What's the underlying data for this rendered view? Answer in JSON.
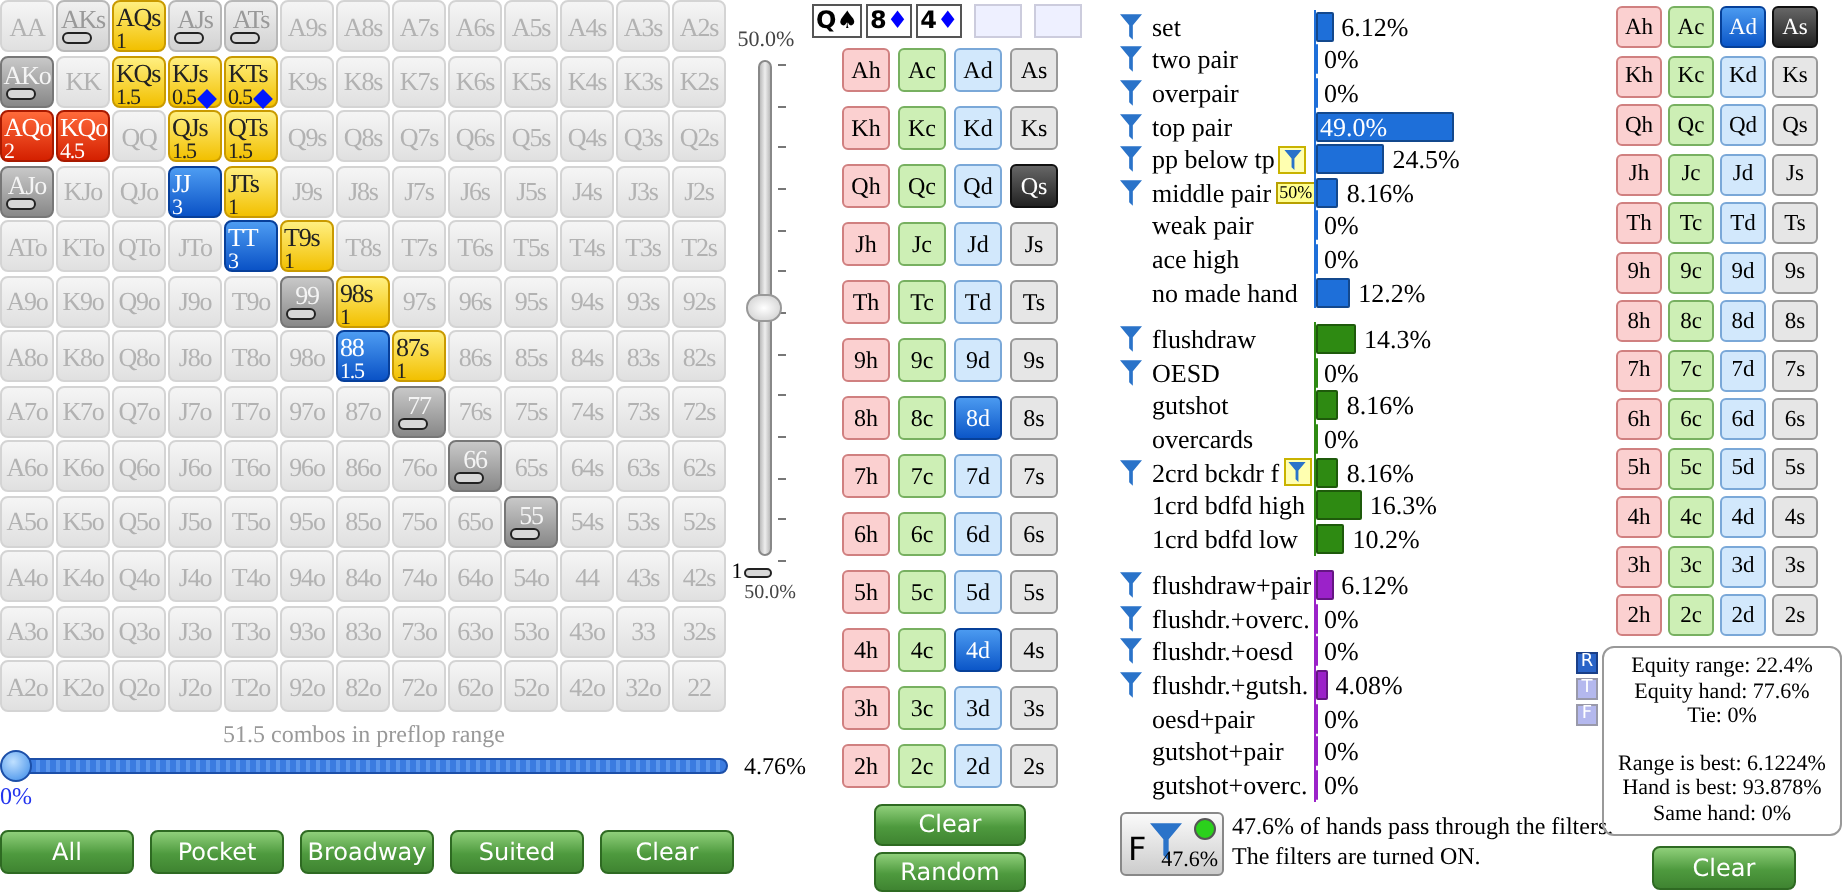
{
  "range_grid": {
    "rows": [
      [
        {
          "label": "AA",
          "selected": false,
          "blocked": false
        },
        {
          "label": "AKs",
          "selected": false,
          "blocked": true
        },
        {
          "label": "AQs",
          "selected": true,
          "blocked": false,
          "weight": "1"
        },
        {
          "label": "AJs",
          "selected": false,
          "blocked": true
        },
        {
          "label": "ATs",
          "selected": false,
          "blocked": true
        },
        {
          "label": "A9s",
          "selected": false,
          "blocked": false
        },
        {
          "label": "A8s",
          "selected": false,
          "blocked": false
        },
        {
          "label": "A7s",
          "selected": false,
          "blocked": false
        },
        {
          "label": "A6s",
          "selected": false,
          "blocked": false
        },
        {
          "label": "A5s",
          "selected": false,
          "blocked": false
        },
        {
          "label": "A4s",
          "selected": false,
          "blocked": false
        },
        {
          "label": "A3s",
          "selected": false,
          "blocked": false
        },
        {
          "label": "A2s",
          "selected": false,
          "blocked": false
        }
      ],
      [
        {
          "label": "AKo",
          "selected": false,
          "blocked": true
        },
        {
          "label": "KK",
          "selected": false,
          "blocked": false
        },
        {
          "label": "KQs",
          "selected": true,
          "blocked": false,
          "weight": "1.5"
        },
        {
          "label": "KJs",
          "selected": true,
          "blocked": false,
          "weight": "0.5",
          "blocker": true
        },
        {
          "label": "KTs",
          "selected": true,
          "blocked": false,
          "weight": "0.5",
          "blocker": true
        },
        {
          "label": "K9s",
          "selected": false,
          "blocked": false
        },
        {
          "label": "K8s",
          "selected": false,
          "blocked": false
        },
        {
          "label": "K7s",
          "selected": false,
          "blocked": false
        },
        {
          "label": "K6s",
          "selected": false,
          "blocked": false
        },
        {
          "label": "K5s",
          "selected": false,
          "blocked": false
        },
        {
          "label": "K4s",
          "selected": false,
          "blocked": false
        },
        {
          "label": "K3s",
          "selected": false,
          "blocked": false
        },
        {
          "label": "K2s",
          "selected": false,
          "blocked": false
        }
      ],
      [
        {
          "label": "AQo",
          "selected": true,
          "blocked": false,
          "weight": "2"
        },
        {
          "label": "KQo",
          "selected": true,
          "blocked": false,
          "weight": "4.5"
        },
        {
          "label": "QQ",
          "selected": false,
          "blocked": false
        },
        {
          "label": "QJs",
          "selected": true,
          "blocked": false,
          "weight": "1.5"
        },
        {
          "label": "QTs",
          "selected": true,
          "blocked": false,
          "weight": "1.5"
        },
        {
          "label": "Q9s",
          "selected": false,
          "blocked": false
        },
        {
          "label": "Q8s",
          "selected": false,
          "blocked": false
        },
        {
          "label": "Q7s",
          "selected": false,
          "blocked": false
        },
        {
          "label": "Q6s",
          "selected": false,
          "blocked": false
        },
        {
          "label": "Q5s",
          "selected": false,
          "blocked": false
        },
        {
          "label": "Q4s",
          "selected": false,
          "blocked": false
        },
        {
          "label": "Q3s",
          "selected": false,
          "blocked": false
        },
        {
          "label": "Q2s",
          "selected": false,
          "blocked": false
        }
      ],
      [
        {
          "label": "AJo",
          "selected": false,
          "blocked": true
        },
        {
          "label": "KJo",
          "selected": false,
          "blocked": false
        },
        {
          "label": "QJo",
          "selected": false,
          "blocked": false
        },
        {
          "label": "JJ",
          "selected": true,
          "blocked": false,
          "weight": "3"
        },
        {
          "label": "JTs",
          "selected": true,
          "blocked": false,
          "weight": "1"
        },
        {
          "label": "J9s",
          "selected": false,
          "blocked": false
        },
        {
          "label": "J8s",
          "selected": false,
          "blocked": false
        },
        {
          "label": "J7s",
          "selected": false,
          "blocked": false
        },
        {
          "label": "J6s",
          "selected": false,
          "blocked": false
        },
        {
          "label": "J5s",
          "selected": false,
          "blocked": false
        },
        {
          "label": "J4s",
          "selected": false,
          "blocked": false
        },
        {
          "label": "J3s",
          "selected": false,
          "blocked": false
        },
        {
          "label": "J2s",
          "selected": false,
          "blocked": false
        }
      ],
      [
        {
          "label": "ATo",
          "selected": false,
          "blocked": false
        },
        {
          "label": "KTo",
          "selected": false,
          "blocked": false
        },
        {
          "label": "QTo",
          "selected": false,
          "blocked": false
        },
        {
          "label": "JTo",
          "selected": false,
          "blocked": false
        },
        {
          "label": "TT",
          "selected": true,
          "blocked": false,
          "weight": "3"
        },
        {
          "label": "T9s",
          "selected": true,
          "blocked": false,
          "weight": "1"
        },
        {
          "label": "T8s",
          "selected": false,
          "blocked": false
        },
        {
          "label": "T7s",
          "selected": false,
          "blocked": false
        },
        {
          "label": "T6s",
          "selected": false,
          "blocked": false
        },
        {
          "label": "T5s",
          "selected": false,
          "blocked": false
        },
        {
          "label": "T4s",
          "selected": false,
          "blocked": false
        },
        {
          "label": "T3s",
          "selected": false,
          "blocked": false
        },
        {
          "label": "T2s",
          "selected": false,
          "blocked": false
        }
      ],
      [
        {
          "label": "A9o",
          "selected": false,
          "blocked": false
        },
        {
          "label": "K9o",
          "selected": false,
          "blocked": false
        },
        {
          "label": "Q9o",
          "selected": false,
          "blocked": false
        },
        {
          "label": "J9o",
          "selected": false,
          "blocked": false
        },
        {
          "label": "T9o",
          "selected": false,
          "blocked": false
        },
        {
          "label": "99",
          "selected": false,
          "blocked": true
        },
        {
          "label": "98s",
          "selected": true,
          "blocked": false,
          "weight": "1"
        },
        {
          "label": "97s",
          "selected": false,
          "blocked": false
        },
        {
          "label": "96s",
          "selected": false,
          "blocked": false
        },
        {
          "label": "95s",
          "selected": false,
          "blocked": false
        },
        {
          "label": "94s",
          "selected": false,
          "blocked": false
        },
        {
          "label": "93s",
          "selected": false,
          "blocked": false
        },
        {
          "label": "92s",
          "selected": false,
          "blocked": false
        }
      ],
      [
        {
          "label": "A8o",
          "selected": false,
          "blocked": false
        },
        {
          "label": "K8o",
          "selected": false,
          "blocked": false
        },
        {
          "label": "Q8o",
          "selected": false,
          "blocked": false
        },
        {
          "label": "J8o",
          "selected": false,
          "blocked": false
        },
        {
          "label": "T8o",
          "selected": false,
          "blocked": false
        },
        {
          "label": "98o",
          "selected": false,
          "blocked": false
        },
        {
          "label": "88",
          "selected": true,
          "blocked": false,
          "weight": "1.5"
        },
        {
          "label": "87s",
          "selected": true,
          "blocked": false,
          "weight": "1"
        },
        {
          "label": "86s",
          "selected": false,
          "blocked": false
        },
        {
          "label": "85s",
          "selected": false,
          "blocked": false
        },
        {
          "label": "84s",
          "selected": false,
          "blocked": false
        },
        {
          "label": "83s",
          "selected": false,
          "blocked": false
        },
        {
          "label": "82s",
          "selected": false,
          "blocked": false
        }
      ],
      [
        {
          "label": "A7o",
          "selected": false,
          "blocked": false
        },
        {
          "label": "K7o",
          "selected": false,
          "blocked": false
        },
        {
          "label": "Q7o",
          "selected": false,
          "blocked": false
        },
        {
          "label": "J7o",
          "selected": false,
          "blocked": false
        },
        {
          "label": "T7o",
          "selected": false,
          "blocked": false
        },
        {
          "label": "97o",
          "selected": false,
          "blocked": false
        },
        {
          "label": "87o",
          "selected": false,
          "blocked": false
        },
        {
          "label": "77",
          "selected": false,
          "blocked": true
        },
        {
          "label": "76s",
          "selected": false,
          "blocked": false
        },
        {
          "label": "75s",
          "selected": false,
          "blocked": false
        },
        {
          "label": "74s",
          "selected": false,
          "blocked": false
        },
        {
          "label": "73s",
          "selected": false,
          "blocked": false
        },
        {
          "label": "72s",
          "selected": false,
          "blocked": false
        }
      ],
      [
        {
          "label": "A6o",
          "selected": false,
          "blocked": false
        },
        {
          "label": "K6o",
          "selected": false,
          "blocked": false
        },
        {
          "label": "Q6o",
          "selected": false,
          "blocked": false
        },
        {
          "label": "J6o",
          "selected": false,
          "blocked": false
        },
        {
          "label": "T6o",
          "selected": false,
          "blocked": false
        },
        {
          "label": "96o",
          "selected": false,
          "blocked": false
        },
        {
          "label": "86o",
          "selected": false,
          "blocked": false
        },
        {
          "label": "76o",
          "selected": false,
          "blocked": false
        },
        {
          "label": "66",
          "selected": false,
          "blocked": true
        },
        {
          "label": "65s",
          "selected": false,
          "blocked": false
        },
        {
          "label": "64s",
          "selected": false,
          "blocked": false
        },
        {
          "label": "63s",
          "selected": false,
          "blocked": false
        },
        {
          "label": "62s",
          "selected": false,
          "blocked": false
        }
      ],
      [
        {
          "label": "A5o",
          "selected": false,
          "blocked": false
        },
        {
          "label": "K5o",
          "selected": false,
          "blocked": false
        },
        {
          "label": "Q5o",
          "selected": false,
          "blocked": false
        },
        {
          "label": "J5o",
          "selected": false,
          "blocked": false
        },
        {
          "label": "T5o",
          "selected": false,
          "blocked": false
        },
        {
          "label": "95o",
          "selected": false,
          "blocked": false
        },
        {
          "label": "85o",
          "selected": false,
          "blocked": false
        },
        {
          "label": "75o",
          "selected": false,
          "blocked": false
        },
        {
          "label": "65o",
          "selected": false,
          "blocked": false
        },
        {
          "label": "55",
          "selected": false,
          "blocked": true
        },
        {
          "label": "54s",
          "selected": false,
          "blocked": false
        },
        {
          "label": "53s",
          "selected": false,
          "blocked": false
        },
        {
          "label": "52s",
          "selected": false,
          "blocked": false
        }
      ],
      [
        {
          "label": "A4o",
          "selected": false,
          "blocked": false
        },
        {
          "label": "K4o",
          "selected": false,
          "blocked": false
        },
        {
          "label": "Q4o",
          "selected": false,
          "blocked": false
        },
        {
          "label": "J4o",
          "selected": false,
          "blocked": false
        },
        {
          "label": "T4o",
          "selected": false,
          "blocked": false
        },
        {
          "label": "94o",
          "selected": false,
          "blocked": false
        },
        {
          "label": "84o",
          "selected": false,
          "blocked": false
        },
        {
          "label": "74o",
          "selected": false,
          "blocked": false
        },
        {
          "label": "64o",
          "selected": false,
          "blocked": false
        },
        {
          "label": "54o",
          "selected": false,
          "blocked": false
        },
        {
          "label": "44",
          "selected": false,
          "blocked": false
        },
        {
          "label": "43s",
          "selected": false,
          "blocked": false
        },
        {
          "label": "42s",
          "selected": false,
          "blocked": false
        }
      ],
      [
        {
          "label": "A3o",
          "selected": false,
          "blocked": false
        },
        {
          "label": "K3o",
          "selected": false,
          "blocked": false
        },
        {
          "label": "Q3o",
          "selected": false,
          "blocked": false
        },
        {
          "label": "J3o",
          "selected": false,
          "blocked": false
        },
        {
          "label": "T3o",
          "selected": false,
          "blocked": false
        },
        {
          "label": "93o",
          "selected": false,
          "blocked": false
        },
        {
          "label": "83o",
          "selected": false,
          "blocked": false
        },
        {
          "label": "73o",
          "selected": false,
          "blocked": false
        },
        {
          "label": "63o",
          "selected": false,
          "blocked": false
        },
        {
          "label": "53o",
          "selected": false,
          "blocked": false
        },
        {
          "label": "43o",
          "selected": false,
          "blocked": false
        },
        {
          "label": "33",
          "selected": false,
          "blocked": false
        },
        {
          "label": "32s",
          "selected": false,
          "blocked": false
        }
      ],
      [
        {
          "label": "A2o",
          "selected": false,
          "blocked": false
        },
        {
          "label": "K2o",
          "selected": false,
          "blocked": false
        },
        {
          "label": "Q2o",
          "selected": false,
          "blocked": false
        },
        {
          "label": "J2o",
          "selected": false,
          "blocked": false
        },
        {
          "label": "T2o",
          "selected": false,
          "blocked": false
        },
        {
          "label": "92o",
          "selected": false,
          "blocked": false
        },
        {
          "label": "82o",
          "selected": false,
          "blocked": false
        },
        {
          "label": "72o",
          "selected": false,
          "blocked": false
        },
        {
          "label": "62o",
          "selected": false,
          "blocked": false
        },
        {
          "label": "52o",
          "selected": false,
          "blocked": false
        },
        {
          "label": "42o",
          "selected": false,
          "blocked": false
        },
        {
          "label": "32o",
          "selected": false,
          "blocked": false
        },
        {
          "label": "22",
          "selected": false,
          "blocked": false
        }
      ]
    ]
  },
  "vslider": {
    "top_label": "50.0%",
    "min_label": "1",
    "bottom_label": "50.0%",
    "level": 0.5
  },
  "combos_text": "51.5 combos in preflop range",
  "hslider": {
    "level": 0,
    "min_label": "0%",
    "value_label": "4.76%"
  },
  "range_buttons": [
    "All",
    "Pocket",
    "Broadway",
    "Suited",
    "Clear"
  ],
  "board": [
    {
      "kind": "card",
      "rank": "Q",
      "suit": "♠",
      "color": "#000000"
    },
    {
      "kind": "card",
      "rank": "8",
      "suit": "♦",
      "color": "#0000ff"
    },
    {
      "kind": "card",
      "rank": "4",
      "suit": "♦",
      "color": "#0000ff"
    },
    {
      "kind": "empty"
    },
    {
      "kind": "empty"
    }
  ],
  "board_cards": {
    "rows": [
      [
        {
          "label": "Ah",
          "selected": false,
          "dead": false
        },
        {
          "label": "Ac",
          "selected": false,
          "dead": false
        },
        {
          "label": "Ad",
          "selected": false,
          "dead": false
        },
        {
          "label": "As",
          "selected": false,
          "dead": false
        }
      ],
      [
        {
          "label": "Kh",
          "selected": false,
          "dead": false
        },
        {
          "label": "Kc",
          "selected": false,
          "dead": false
        },
        {
          "label": "Kd",
          "selected": false,
          "dead": false
        },
        {
          "label": "Ks",
          "selected": false,
          "dead": false
        }
      ],
      [
        {
          "label": "Qh",
          "selected": false,
          "dead": false
        },
        {
          "label": "Qc",
          "selected": false,
          "dead": false
        },
        {
          "label": "Qd",
          "selected": false,
          "dead": false
        },
        {
          "label": "Qs",
          "selected": false,
          "dead": true
        }
      ],
      [
        {
          "label": "Jh",
          "selected": false,
          "dead": false
        },
        {
          "label": "Jc",
          "selected": false,
          "dead": false
        },
        {
          "label": "Jd",
          "selected": false,
          "dead": false
        },
        {
          "label": "Js",
          "selected": false,
          "dead": false
        }
      ],
      [
        {
          "label": "Th",
          "selected": false,
          "dead": false
        },
        {
          "label": "Tc",
          "selected": false,
          "dead": false
        },
        {
          "label": "Td",
          "selected": false,
          "dead": false
        },
        {
          "label": "Ts",
          "selected": false,
          "dead": false
        }
      ],
      [
        {
          "label": "9h",
          "selected": false,
          "dead": false
        },
        {
          "label": "9c",
          "selected": false,
          "dead": false
        },
        {
          "label": "9d",
          "selected": false,
          "dead": false
        },
        {
          "label": "9s",
          "selected": false,
          "dead": false
        }
      ],
      [
        {
          "label": "8h",
          "selected": false,
          "dead": false
        },
        {
          "label": "8c",
          "selected": false,
          "dead": false
        },
        {
          "label": "8d",
          "selected": true,
          "dead": false
        },
        {
          "label": "8s",
          "selected": false,
          "dead": false
        }
      ],
      [
        {
          "label": "7h",
          "selected": false,
          "dead": false
        },
        {
          "label": "7c",
          "selected": false,
          "dead": false
        },
        {
          "label": "7d",
          "selected": false,
          "dead": false
        },
        {
          "label": "7s",
          "selected": false,
          "dead": false
        }
      ],
      [
        {
          "label": "6h",
          "selected": false,
          "dead": false
        },
        {
          "label": "6c",
          "selected": false,
          "dead": false
        },
        {
          "label": "6d",
          "selected": false,
          "dead": false
        },
        {
          "label": "6s",
          "selected": false,
          "dead": false
        }
      ],
      [
        {
          "label": "5h",
          "selected": false,
          "dead": false
        },
        {
          "label": "5c",
          "selected": false,
          "dead": false
        },
        {
          "label": "5d",
          "selected": false,
          "dead": false
        },
        {
          "label": "5s",
          "selected": false,
          "dead": false
        }
      ],
      [
        {
          "label": "4h",
          "selected": false,
          "dead": false
        },
        {
          "label": "4c",
          "selected": false,
          "dead": false
        },
        {
          "label": "4d",
          "selected": true,
          "dead": false
        },
        {
          "label": "4s",
          "selected": false,
          "dead": false
        }
      ],
      [
        {
          "label": "3h",
          "selected": false,
          "dead": false
        },
        {
          "label": "3c",
          "selected": false,
          "dead": false
        },
        {
          "label": "3d",
          "selected": false,
          "dead": false
        },
        {
          "label": "3s",
          "selected": false,
          "dead": false
        }
      ],
      [
        {
          "label": "2h",
          "selected": false,
          "dead": false
        },
        {
          "label": "2c",
          "selected": false,
          "dead": false
        },
        {
          "label": "2d",
          "selected": false,
          "dead": false
        },
        {
          "label": "2s",
          "selected": false,
          "dead": false
        }
      ]
    ]
  },
  "board_buttons": [
    "Clear",
    "Random"
  ],
  "stats": {
    "sections": [
      {
        "color": "#1e6fd9",
        "rows": [
          {
            "label": "set",
            "filter": true,
            "level": 0.0612,
            "value": "6.12%"
          },
          {
            "label": "two pair",
            "filter": true,
            "level": 0,
            "value": "0%"
          },
          {
            "label": "overpair",
            "filter": true,
            "level": 0,
            "value": "0%"
          },
          {
            "label": "top pair",
            "filter": true,
            "level": 0.49,
            "value": "49.0%"
          },
          {
            "label": "pp below tp",
            "filter": true,
            "marker": {
              "kind": "filter"
            },
            "level": 0.245,
            "value": "24.5%"
          },
          {
            "label": "middle pair",
            "filter": true,
            "marker": {
              "kind": "text",
              "text": "50%"
            },
            "level": 0.0816,
            "value": "8.16%"
          },
          {
            "label": "weak pair",
            "filter": false,
            "level": 0,
            "value": "0%"
          },
          {
            "label": "ace high",
            "filter": false,
            "level": 0,
            "value": "0%"
          },
          {
            "label": "no made hand",
            "filter": false,
            "level": 0.122,
            "value": "12.2%"
          }
        ]
      },
      {
        "color": "#2e8a12",
        "rows": [
          {
            "label": "flushdraw",
            "filter": true,
            "level": 0.143,
            "value": "14.3%"
          },
          {
            "label": "OESD",
            "filter": true,
            "level": 0,
            "value": "0%"
          },
          {
            "label": "gutshot",
            "filter": false,
            "level": 0.0816,
            "value": "8.16%"
          },
          {
            "label": "overcards",
            "filter": false,
            "level": 0,
            "value": "0%"
          },
          {
            "label": "2crd bckdr f",
            "filter": true,
            "marker": {
              "kind": "filter"
            },
            "level": 0.0816,
            "value": "8.16%"
          },
          {
            "label": "1crd bdfd high",
            "filter": false,
            "level": 0.163,
            "value": "16.3%"
          },
          {
            "label": "1crd bdfd low",
            "filter": false,
            "level": 0.102,
            "value": "10.2%"
          }
        ]
      },
      {
        "color": "#9b22c9",
        "rows": [
          {
            "label": "flushdraw+pair",
            "filter": true,
            "level": 0.0612,
            "value": "6.12%"
          },
          {
            "label": "flushdr.+overc.",
            "filter": true,
            "level": 0,
            "value": "0%"
          },
          {
            "label": "flushdr.+oesd",
            "filter": true,
            "level": 0,
            "value": "0%"
          },
          {
            "label": "flushdr.+gutsh.",
            "filter": true,
            "level": 0.0408,
            "value": "4.08%"
          },
          {
            "label": "oesd+pair",
            "filter": false,
            "level": 0,
            "value": "0%"
          },
          {
            "label": "gutshot+pair",
            "filter": false,
            "level": 0,
            "value": "0%"
          },
          {
            "label": "gutshot+overc.",
            "filter": false,
            "level": 0,
            "value": "0%"
          }
        ]
      }
    ]
  },
  "filter_summary": {
    "icon_label": "F",
    "percent": "47.6%",
    "on": true,
    "lines": [
      "47.6% of hands pass through the filters.",
      "The filters are turned ON."
    ]
  },
  "hand_cards": {
    "rows": [
      [
        {
          "label": "Ah",
          "selected": false,
          "dead": false
        },
        {
          "label": "Ac",
          "selected": false,
          "dead": false
        },
        {
          "label": "Ad",
          "selected": true,
          "dead": false
        },
        {
          "label": "As",
          "selected": false,
          "dead": true
        }
      ],
      [
        {
          "label": "Kh",
          "selected": false,
          "dead": false
        },
        {
          "label": "Kc",
          "selected": false,
          "dead": false
        },
        {
          "label": "Kd",
          "selected": false,
          "dead": false
        },
        {
          "label": "Ks",
          "selected": false,
          "dead": false
        }
      ],
      [
        {
          "label": "Qh",
          "selected": false,
          "dead": false
        },
        {
          "label": "Qc",
          "selected": false,
          "dead": false
        },
        {
          "label": "Qd",
          "selected": false,
          "dead": false
        },
        {
          "label": "Qs",
          "selected": false,
          "dead": false
        }
      ],
      [
        {
          "label": "Jh",
          "selected": false,
          "dead": false
        },
        {
          "label": "Jc",
          "selected": false,
          "dead": false
        },
        {
          "label": "Jd",
          "selected": false,
          "dead": false
        },
        {
          "label": "Js",
          "selected": false,
          "dead": false
        }
      ],
      [
        {
          "label": "Th",
          "selected": false,
          "dead": false
        },
        {
          "label": "Tc",
          "selected": false,
          "dead": false
        },
        {
          "label": "Td",
          "selected": false,
          "dead": false
        },
        {
          "label": "Ts",
          "selected": false,
          "dead": false
        }
      ],
      [
        {
          "label": "9h",
          "selected": false,
          "dead": false
        },
        {
          "label": "9c",
          "selected": false,
          "dead": false
        },
        {
          "label": "9d",
          "selected": false,
          "dead": false
        },
        {
          "label": "9s",
          "selected": false,
          "dead": false
        }
      ],
      [
        {
          "label": "8h",
          "selected": false,
          "dead": false
        },
        {
          "label": "8c",
          "selected": false,
          "dead": false
        },
        {
          "label": "8d",
          "selected": false,
          "dead": false
        },
        {
          "label": "8s",
          "selected": false,
          "dead": false
        }
      ],
      [
        {
          "label": "7h",
          "selected": false,
          "dead": false
        },
        {
          "label": "7c",
          "selected": false,
          "dead": false
        },
        {
          "label": "7d",
          "selected": false,
          "dead": false
        },
        {
          "label": "7s",
          "selected": false,
          "dead": false
        }
      ],
      [
        {
          "label": "6h",
          "selected": false,
          "dead": false
        },
        {
          "label": "6c",
          "selected": false,
          "dead": false
        },
        {
          "label": "6d",
          "selected": false,
          "dead": false
        },
        {
          "label": "6s",
          "selected": false,
          "dead": false
        }
      ],
      [
        {
          "label": "5h",
          "selected": false,
          "dead": false
        },
        {
          "label": "5c",
          "selected": false,
          "dead": false
        },
        {
          "label": "5d",
          "selected": false,
          "dead": false
        },
        {
          "label": "5s",
          "selected": false,
          "dead": false
        }
      ],
      [
        {
          "label": "4h",
          "selected": false,
          "dead": false
        },
        {
          "label": "4c",
          "selected": false,
          "dead": false
        },
        {
          "label": "4d",
          "selected": false,
          "dead": false
        },
        {
          "label": "4s",
          "selected": false,
          "dead": false
        }
      ],
      [
        {
          "label": "3h",
          "selected": false,
          "dead": false
        },
        {
          "label": "3c",
          "selected": false,
          "dead": false
        },
        {
          "label": "3d",
          "selected": false,
          "dead": false
        },
        {
          "label": "3s",
          "selected": false,
          "dead": false
        }
      ],
      [
        {
          "label": "2h",
          "selected": false,
          "dead": false
        },
        {
          "label": "2c",
          "selected": false,
          "dead": false
        },
        {
          "label": "2d",
          "selected": false,
          "dead": false
        },
        {
          "label": "2s",
          "selected": false,
          "dead": false
        }
      ]
    ]
  },
  "equity": {
    "tabs": [
      {
        "label": "R",
        "selected": true
      },
      {
        "label": "T",
        "selected": false
      },
      {
        "label": "F",
        "selected": false
      }
    ],
    "lines": [
      "Equity range: 22.4%",
      "Equity hand: 77.6%",
      "Tie: 0%"
    ],
    "lines2": [
      "Range is best: 6.1224%",
      "Hand is best: 93.878%",
      "Same hand: 0%"
    ]
  },
  "equity_button": "Clear"
}
